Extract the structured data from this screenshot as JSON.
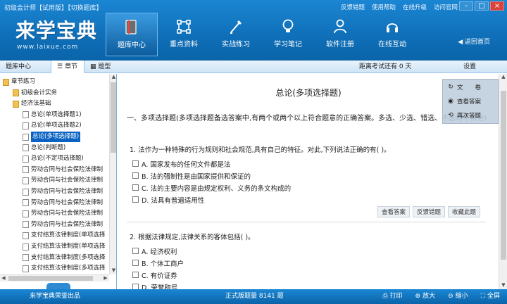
{
  "app": {
    "title": "初级会计师【试用版】【切换题库】",
    "top_links": [
      "反馈错题",
      "使用帮助",
      "在线升级",
      "访问官网"
    ],
    "logo_name": "来学宝典",
    "logo_url": "www.laixue.com",
    "back_home": "返回首页"
  },
  "nav": [
    {
      "label": "题库中心",
      "icon": "book-icon"
    },
    {
      "label": "重点资料",
      "icon": "network-icon"
    },
    {
      "label": "实战练习",
      "icon": "pencil-icon"
    },
    {
      "label": "学习笔记",
      "icon": "lightbulb-icon"
    },
    {
      "label": "软件注册",
      "icon": "user-icon"
    },
    {
      "label": "在线互动",
      "icon": "headset-icon"
    }
  ],
  "subbar": {
    "tab_bank": "题库中心",
    "tab_chapter": "章节",
    "tab_type": "题型",
    "countdown": "距离考试还有 0 天",
    "settings": "设置"
  },
  "tree": [
    {
      "label": "章节练习",
      "level": 0,
      "icon": "folder"
    },
    {
      "label": "初级会计实务",
      "level": 1,
      "icon": "folder"
    },
    {
      "label": "经济法基础",
      "level": 1,
      "icon": "folder"
    },
    {
      "label": "总论(单项选择题1)",
      "level": 2,
      "icon": "doc"
    },
    {
      "label": "总论(单项选择题2)",
      "level": 2,
      "icon": "doc"
    },
    {
      "label": "总论(多项选择题)",
      "level": 2,
      "icon": "doc",
      "selected": true
    },
    {
      "label": "总论(判断题)",
      "level": 2,
      "icon": "doc"
    },
    {
      "label": "总论(不定项选择题)",
      "level": 2,
      "icon": "doc"
    },
    {
      "label": "劳动合同与社会保险法律制",
      "level": 2,
      "icon": "doc"
    },
    {
      "label": "劳动合同与社会保险法律制",
      "level": 2,
      "icon": "doc"
    },
    {
      "label": "劳动合同与社会保险法律制",
      "level": 2,
      "icon": "doc"
    },
    {
      "label": "劳动合同与社会保险法律制",
      "level": 2,
      "icon": "doc"
    },
    {
      "label": "劳动合同与社会保险法律制",
      "level": 2,
      "icon": "doc"
    },
    {
      "label": "劳动合同与社会保险法律制",
      "level": 2,
      "icon": "doc"
    },
    {
      "label": "支付结算法律制度(单项选择",
      "level": 2,
      "icon": "doc"
    },
    {
      "label": "支付结算法律制度(单项选择",
      "level": 2,
      "icon": "doc"
    },
    {
      "label": "支付结算法律制度(多项选择",
      "level": 2,
      "icon": "doc"
    },
    {
      "label": "支付结算法律制度(多项选择",
      "level": 2,
      "icon": "doc"
    }
  ],
  "content": {
    "title": "总论(多项选择题)",
    "description": "一、多项选择题(多项选择题备选答案中,有两个或两个以上符合题意的正确答案。多选、少选、错选、不选均不得分)",
    "questions": [
      {
        "text": "1. 法作为一种特殊的行为规则和社会规范,具有自己的特征。对此,下列说法正确的有( )。",
        "options": [
          "A. 国家发布的任何文件都是法",
          "B. 法的强制性是由国家提供和保证的",
          "C. 法的主要内容是由规定权利、义务的条文构成的",
          "D. 法具有普遍适用性"
        ]
      },
      {
        "text": "2. 根据法律规定,法律关系的客体包括( )。",
        "options": [
          "A. 经济权利",
          "B. 个体工商户",
          "C. 有价证券",
          "D. 荣誉称号"
        ]
      }
    ],
    "actions": [
      "查看答案",
      "反馈错题",
      "收藏此题"
    ]
  },
  "float_tools": [
    {
      "label": "文　　卷",
      "icon": "refresh-icon"
    },
    {
      "label": "查看答案",
      "icon": "eye-icon"
    },
    {
      "label": "再次答题",
      "icon": "redo-icon"
    }
  ],
  "bottom": {
    "left": "来学宝典荣誉出品",
    "middle": "正式版题量 8141 题",
    "print": "打印",
    "zoom_in": "放大",
    "zoom_out": "缩小",
    "fullscreen": "全屏"
  }
}
